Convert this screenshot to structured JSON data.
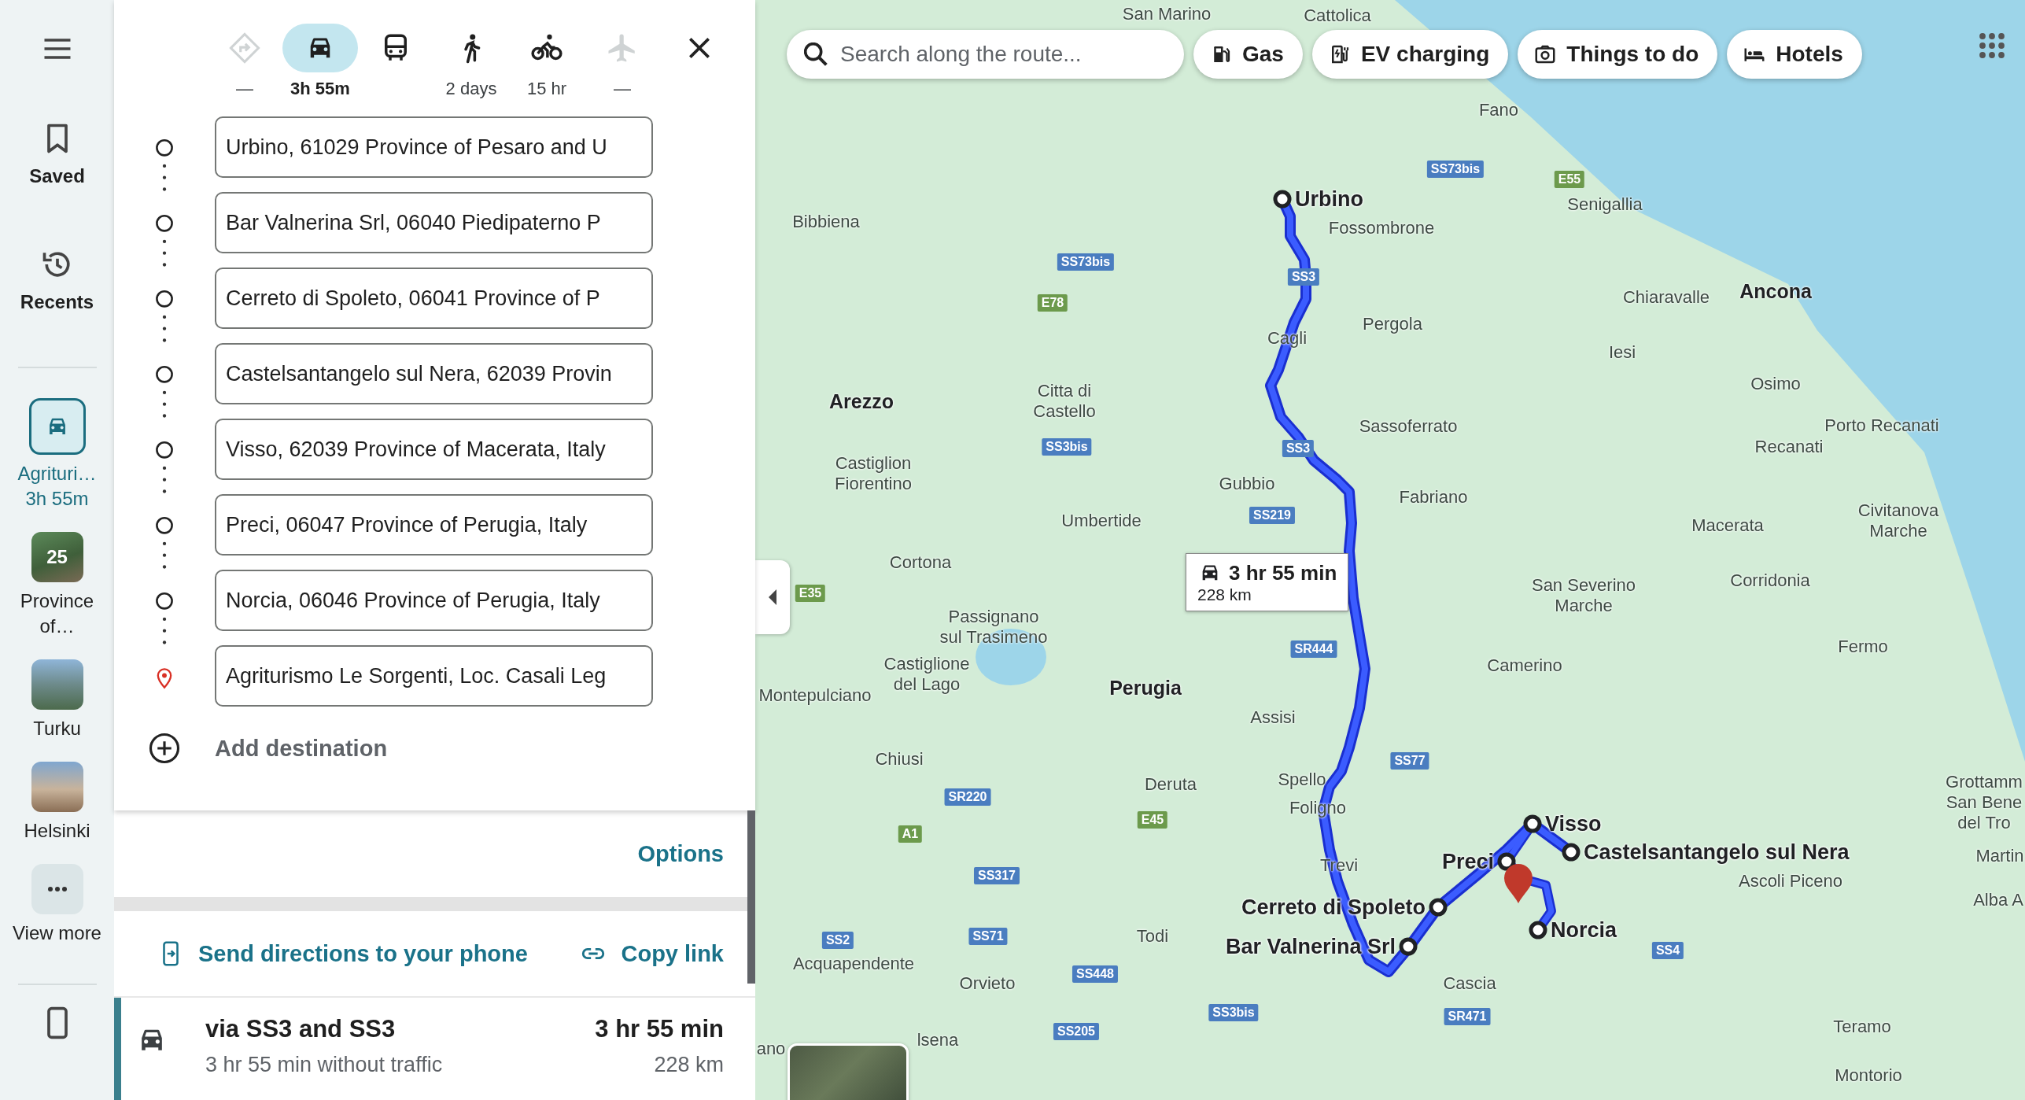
{
  "rail": {
    "items": [
      {
        "kind": "menu"
      },
      {
        "kind": "saved",
        "label": "Saved"
      },
      {
        "kind": "recents",
        "label": "Recents"
      }
    ],
    "recent": [
      {
        "kind": "route",
        "label": "Agrituri…",
        "sublabel": "3h 55m",
        "selected": true
      },
      {
        "kind": "photo",
        "label": "Province of…",
        "badge": "25",
        "selected": false
      },
      {
        "kind": "photo",
        "label": "Turku",
        "selected": false
      },
      {
        "kind": "photo",
        "label": "Helsinki",
        "selected": false
      },
      {
        "kind": "more",
        "label": "View more",
        "selected": false
      }
    ]
  },
  "directions": {
    "modes": [
      {
        "kind": "best",
        "label": "—",
        "selected": false,
        "disabled": true
      },
      {
        "kind": "drive",
        "label": "3h 55m",
        "selected": true,
        "disabled": false
      },
      {
        "kind": "transit",
        "selected": false,
        "disabled": false
      },
      {
        "kind": "walk",
        "label": "2 days",
        "selected": false,
        "disabled": false
      },
      {
        "kind": "bike",
        "label": "15 hr",
        "selected": false,
        "disabled": false
      },
      {
        "kind": "flight",
        "label": "—",
        "selected": false,
        "disabled": true
      }
    ],
    "stops": [
      {
        "kind": "waypoint",
        "value": "Urbino, 61029 Province of Pesaro and U"
      },
      {
        "kind": "waypoint",
        "value": "Bar Valnerina Srl, 06040 Piedipaterno P"
      },
      {
        "kind": "waypoint",
        "value": "Cerreto di Spoleto, 06041 Province of P"
      },
      {
        "kind": "waypoint",
        "value": "Castelsantangelo sul Nera, 62039 Provin"
      },
      {
        "kind": "waypoint",
        "value": "Visso, 62039 Province of Macerata, Italy"
      },
      {
        "kind": "waypoint",
        "value": "Preci, 06047 Province of Perugia, Italy"
      },
      {
        "kind": "waypoint",
        "value": "Norcia, 06046 Province of Perugia, Italy"
      },
      {
        "kind": "destination",
        "value": "Agriturismo Le Sorgenti, Loc. Casali Leg"
      }
    ],
    "add_destination": "Add destination",
    "options": "Options",
    "send_to_phone": "Send directions to your phone",
    "copy_link": "Copy link",
    "routes": [
      {
        "title": "via SS3 and SS3",
        "duration": "3 hr 55 min",
        "note": "3 hr 55 min without traffic",
        "distance": "228 km",
        "selected": true
      }
    ]
  },
  "map": {
    "search": {
      "placeholder": "Search along the route..."
    },
    "chips": [
      {
        "kind": "gas",
        "label": "Gas"
      },
      {
        "kind": "ev",
        "label": "EV charging"
      },
      {
        "kind": "things",
        "label": "Things to do"
      },
      {
        "kind": "hotels",
        "label": "Hotels"
      }
    ],
    "route_label": {
      "duration": "3 hr 55 min",
      "distance": "228 km"
    },
    "stops": [
      {
        "text": "Urbino"
      },
      {
        "text": "Visso"
      },
      {
        "text": "Preci"
      },
      {
        "text": "Castelsantangelo sul Nera"
      },
      {
        "text": "Cerreto di Spoleto"
      },
      {
        "text": "Bar Valnerina Srl"
      },
      {
        "text": "Norcia"
      }
    ],
    "places": [
      {
        "text": "San Marino",
        "kind": "town"
      },
      {
        "text": "Cattolica",
        "kind": "town"
      },
      {
        "text": "Fano",
        "kind": "town"
      },
      {
        "text": "Senigallia",
        "kind": "town"
      },
      {
        "text": "Fossombrone",
        "kind": "town"
      },
      {
        "text": "Bibbiena",
        "kind": "town"
      },
      {
        "text": "Chiaravalle",
        "kind": "town"
      },
      {
        "text": "Ancona",
        "kind": "city"
      },
      {
        "text": "Pergola",
        "kind": "town"
      },
      {
        "text": "Cagli",
        "kind": "town"
      },
      {
        "text": "Iesi",
        "kind": "town"
      },
      {
        "text": "Arezzo",
        "kind": "city"
      },
      {
        "text": "Citta di\nCastello",
        "kind": "town"
      },
      {
        "text": "Osimo",
        "kind": "town"
      },
      {
        "text": "Sassoferrato",
        "kind": "town"
      },
      {
        "text": "Porto Recanati",
        "kind": "town"
      },
      {
        "text": "Recanati",
        "kind": "town"
      },
      {
        "text": "Castiglion\nFiorentino",
        "kind": "town"
      },
      {
        "text": "Gubbio",
        "kind": "town"
      },
      {
        "text": "Fabriano",
        "kind": "town"
      },
      {
        "text": "Umbertide",
        "kind": "town"
      },
      {
        "text": "Macerata",
        "kind": "town"
      },
      {
        "text": "Civitanova\nMarche",
        "kind": "town"
      },
      {
        "text": "Cortona",
        "kind": "town"
      },
      {
        "text": "San Severino\nMarche",
        "kind": "town"
      },
      {
        "text": "Corridonia",
        "kind": "town"
      },
      {
        "text": "Passignano\nsul Trasimeno",
        "kind": "town"
      },
      {
        "text": "Castiglione\ndel Lago",
        "kind": "town"
      },
      {
        "text": "Fermo",
        "kind": "town"
      },
      {
        "text": "Camerino",
        "kind": "town"
      },
      {
        "text": "Montepulciano",
        "kind": "town"
      },
      {
        "text": "Perugia",
        "kind": "city"
      },
      {
        "text": "Assisi",
        "kind": "town"
      },
      {
        "text": "Chiusi",
        "kind": "town"
      },
      {
        "text": "Deruta",
        "kind": "town"
      },
      {
        "text": "Spello",
        "kind": "town"
      },
      {
        "text": "Foligno",
        "kind": "town"
      },
      {
        "text": "Grottamm\nSan Bene\ndel Tro",
        "kind": "town"
      },
      {
        "text": "Martin",
        "kind": "town"
      },
      {
        "text": "Ascoli Piceno",
        "kind": "town"
      },
      {
        "text": "Alba A",
        "kind": "town"
      },
      {
        "text": "Trevi",
        "kind": "town"
      },
      {
        "text": "Todi",
        "kind": "town"
      },
      {
        "text": "Acquapendente",
        "kind": "town"
      },
      {
        "text": "Orvieto",
        "kind": "town"
      },
      {
        "text": "Cascia",
        "kind": "town"
      },
      {
        "text": "Teramo",
        "kind": "town"
      },
      {
        "text": "lsena",
        "kind": "town"
      },
      {
        "text": "ano",
        "kind": "town"
      },
      {
        "text": "Montorio",
        "kind": "town"
      }
    ],
    "roads": [
      {
        "text": "SS73bis",
        "kind": "national"
      },
      {
        "text": "E55",
        "kind": "european"
      },
      {
        "text": "SS73bis",
        "kind": "national"
      },
      {
        "text": "SS3",
        "kind": "national"
      },
      {
        "text": "E78",
        "kind": "european"
      },
      {
        "text": "SS3bis",
        "kind": "national"
      },
      {
        "text": "SS3",
        "kind": "national"
      },
      {
        "text": "SS219",
        "kind": "national"
      },
      {
        "text": "E35",
        "kind": "european"
      },
      {
        "text": "SR444",
        "kind": "national"
      },
      {
        "text": "SS77",
        "kind": "national"
      },
      {
        "text": "SR220",
        "kind": "national"
      },
      {
        "text": "E45",
        "kind": "european"
      },
      {
        "text": "A1",
        "kind": "european"
      },
      {
        "text": "SS317",
        "kind": "national"
      },
      {
        "text": "SS2",
        "kind": "national"
      },
      {
        "text": "SS71",
        "kind": "national"
      },
      {
        "text": "SS448",
        "kind": "national"
      },
      {
        "text": "SS4",
        "kind": "national"
      },
      {
        "text": "SS3bis",
        "kind": "national"
      },
      {
        "text": "SR471",
        "kind": "national"
      },
      {
        "text": "SS205",
        "kind": "national"
      }
    ]
  }
}
